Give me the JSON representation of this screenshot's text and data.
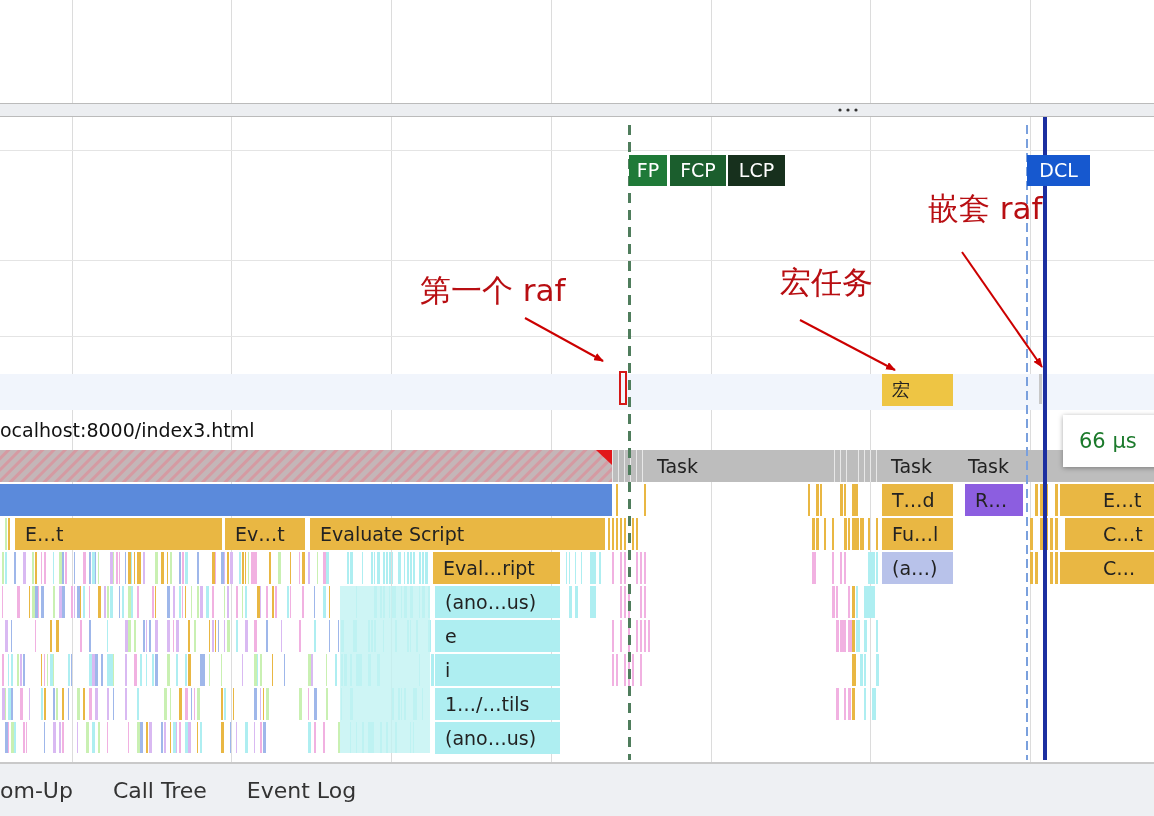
{
  "markers": [
    {
      "label": "FP",
      "color": "#1f7a38"
    },
    {
      "label": "FCP",
      "color": "#1b5e2d"
    },
    {
      "label": "LCP",
      "color": "#17301d"
    },
    {
      "label": "DCL",
      "color": "#1658cf"
    }
  ],
  "annotations": [
    {
      "text": "第一个 raf"
    },
    {
      "text": "宏任务"
    },
    {
      "text": "嵌套 raf"
    }
  ],
  "user_timing": [
    {
      "label": "宏"
    }
  ],
  "track_title": "ocalhost:8000/index3.html",
  "tasks": [
    {
      "label": "Task"
    },
    {
      "label": "Task"
    },
    {
      "label": "Task"
    }
  ],
  "flame_rows": [
    [
      {
        "label": "T…d",
        "color": "#e9b743"
      },
      {
        "label": "R…",
        "color": "#8c5ee0"
      },
      {
        "label": "E…t",
        "color": "#e9b743"
      }
    ],
    [
      {
        "label": "E…t",
        "color": "#e9b743"
      },
      {
        "label": "Ev…t",
        "color": "#e9b743"
      },
      {
        "label": "Evaluate Script",
        "color": "#e9b743"
      },
      {
        "label": "Fu…l",
        "color": "#e9b743"
      },
      {
        "label": "C…t",
        "color": "#e9b743"
      }
    ],
    [
      {
        "label": "Eval…ript",
        "color": "#e9b743"
      },
      {
        "label": "(a…)",
        "color": "#b8c2ea"
      },
      {
        "label": "C…",
        "color": "#e9b743"
      }
    ],
    [
      {
        "label": "(ano…us)",
        "color": "#aeeef1"
      }
    ],
    [
      {
        "label": "e",
        "color": "#aeeef1"
      }
    ],
    [
      {
        "label": "i",
        "color": "#aeeef1"
      }
    ],
    [
      {
        "label": "1…/…tils",
        "color": "#aeeef1"
      }
    ],
    [
      {
        "label": "(ano…us)",
        "color": "#aeeef1"
      }
    ]
  ],
  "tooltip": {
    "value": "66 μs"
  },
  "bottom_tabs": [
    {
      "label": "om-Up"
    },
    {
      "label": "Call Tree"
    },
    {
      "label": "Event Log"
    }
  ]
}
